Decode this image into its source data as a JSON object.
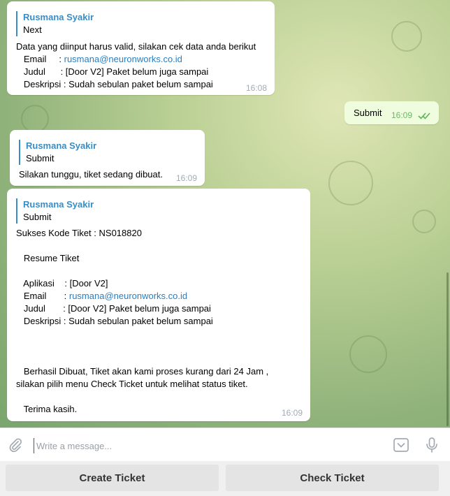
{
  "messages": {
    "m1": {
      "reply_author": "Rusmana Syakir",
      "reply_text": "Next",
      "intro": "Data yang diinput harus valid, silakan cek data anda berikut",
      "email_label": "   Email     : ",
      "email_value": "rusmana@neuronworks.co.id",
      "judul_line": "   Judul      : [Door V2] Paket belum juga sampai",
      "deskripsi_line": "   Deskripsi : Sudah sebulan paket belum sampai",
      "time": "16:08"
    },
    "m2": {
      "text": "Submit",
      "time": "16:09"
    },
    "m3": {
      "reply_author": "Rusmana Syakir",
      "reply_text": "Submit",
      "text": "Silakan tunggu, tiket sedang dibuat.",
      "time": "16:09"
    },
    "m4": {
      "reply_author": "Rusmana Syakir",
      "reply_text": "Submit",
      "kode": "Sukses Kode Tiket : NS018820",
      "resume": "   Resume Tiket",
      "aplikasi_line": "   Aplikasi    : [Door V2]",
      "email_label": "   Email       : ",
      "email_value": "rusmana@neuronworks.co.id",
      "judul_line": "   Judul       : [Door V2] Paket belum juga sampai",
      "deskripsi_line": "   Deskripsi : Sudah sebulan paket belum sampai",
      "berhasil_1": "   Berhasil Dibuat, Tiket akan kami proses kurang dari 24 Jam ,",
      "berhasil_2": "silakan pilih menu Check Ticket untuk melihat status tiket.",
      "terima": "   Terima kasih.",
      "time": "16:09"
    }
  },
  "composer": {
    "placeholder": "Write a message..."
  },
  "keyboard": {
    "create": "Create Ticket",
    "check": "Check Ticket"
  },
  "colors": {
    "link": "#2a7ec0",
    "reply_accent": "#3a8cc2",
    "outgoing_bubble": "#effdde"
  }
}
